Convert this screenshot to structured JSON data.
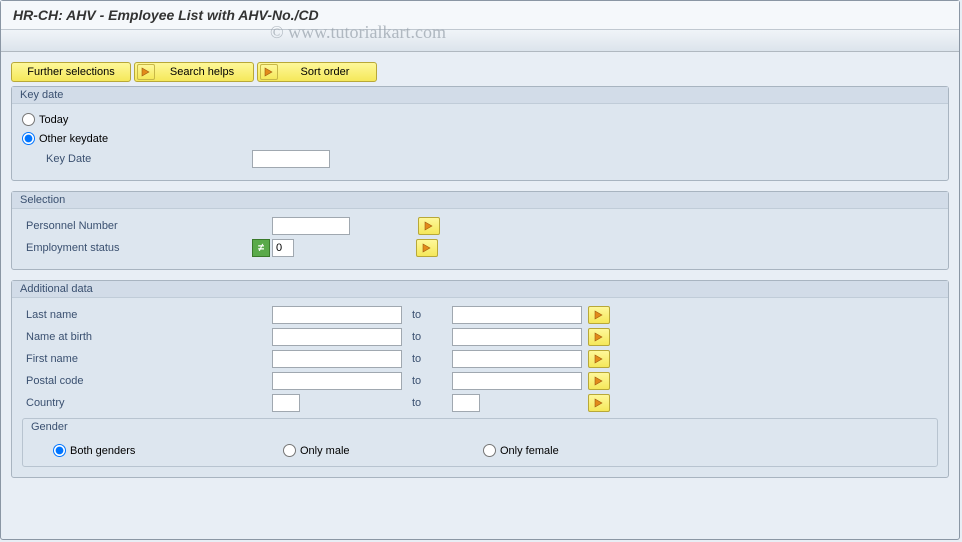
{
  "title": "HR-CH:  AHV - Employee List with AHV-No./CD",
  "watermark": "© www.tutorialkart.com",
  "buttons": {
    "further_selections": "Further selections",
    "search_helps": "Search helps",
    "sort_order": "Sort order"
  },
  "key_date": {
    "legend": "Key date",
    "today": "Today",
    "other": "Other keydate",
    "key_date_label": "Key Date",
    "key_date_value": ""
  },
  "selection": {
    "legend": "Selection",
    "personnel_number_label": "Personnel Number",
    "personnel_number_value": "",
    "employment_status_label": "Employment status",
    "employment_status_value": "0"
  },
  "additional": {
    "legend": "Additional data",
    "to_label": "to",
    "rows": [
      {
        "label": "Last name",
        "from": "",
        "to": ""
      },
      {
        "label": "Name at birth",
        "from": "",
        "to": ""
      },
      {
        "label": "First name",
        "from": "",
        "to": ""
      },
      {
        "label": "Postal code",
        "from": "",
        "to": ""
      },
      {
        "label": "Country",
        "from": "",
        "to": ""
      }
    ],
    "gender": {
      "legend": "Gender",
      "both": "Both genders",
      "male": "Only male",
      "female": "Only female"
    }
  }
}
